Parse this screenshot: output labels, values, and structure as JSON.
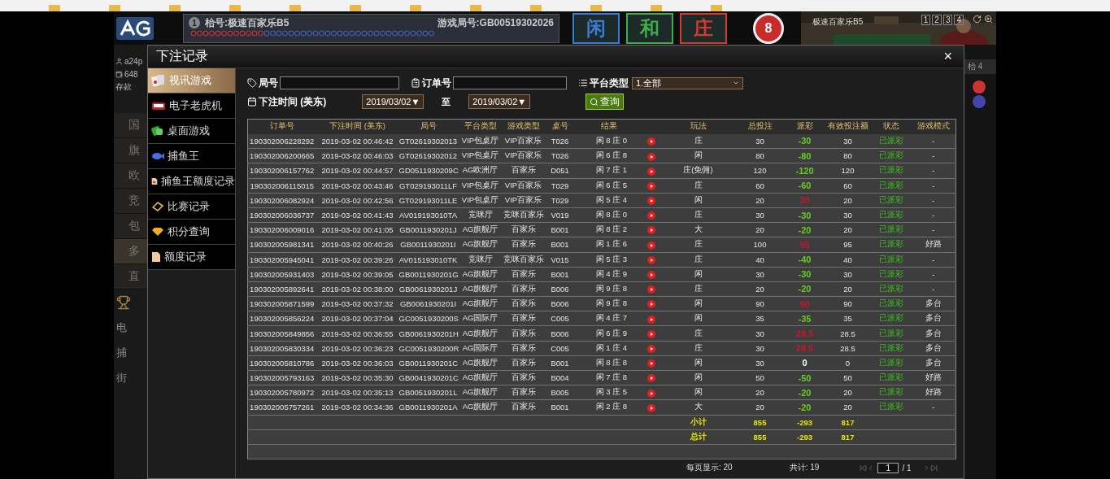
{
  "background": {
    "player": {
      "name": "a24p",
      "balance": "648",
      "deposit": "存款"
    },
    "header": {
      "table_number": "1",
      "table_name": "枱号:极速百家乐B5",
      "round": "游戏局号:GB00519302026",
      "bets": [
        {
          "label": "闲",
          "color": "#3a7bd5"
        },
        {
          "label": "和",
          "color": "#3fae49"
        },
        {
          "label": "庄",
          "color": "#d33a2c"
        }
      ],
      "result_number": "8"
    },
    "video": {
      "title": "极速百家乐B5",
      "views": [
        {
          "label": "1",
          "selected": false
        },
        {
          "label": "2",
          "selected": false
        },
        {
          "label": "3",
          "selected": false
        },
        {
          "label": "4",
          "selected": false
        }
      ]
    },
    "menu": [
      {
        "label": "国",
        "selected": false
      },
      {
        "label": "旗",
        "selected": false
      },
      {
        "label": "欧",
        "selected": false
      },
      {
        "label": "竞",
        "selected": false
      },
      {
        "label": "包",
        "selected": false
      },
      {
        "label": "多",
        "selected": true
      },
      {
        "label": "直",
        "selected": false
      }
    ],
    "lower_menu": [
      "电",
      "捕",
      "街"
    ],
    "right_tab": "枱 4"
  },
  "dialog": {
    "title": "下注记录",
    "close": "×",
    "sidebar": [
      {
        "label": "视讯游戏",
        "selected": true
      },
      {
        "label": "电子老虎机",
        "selected": false
      },
      {
        "label": "桌面游戏",
        "selected": false
      },
      {
        "label": "捕鱼王",
        "selected": false
      },
      {
        "label": "捕鱼王额度记录",
        "selected": false
      },
      {
        "label": "比赛记录",
        "selected": false
      },
      {
        "label": "积分查询",
        "selected": false
      },
      {
        "label": "额度记录",
        "selected": false
      }
    ],
    "filters": {
      "round_label": "局号",
      "order_label": "订单号",
      "platform_label": "平台类型",
      "platform_value": "1.全部",
      "time_label": "下注时间 (美东)",
      "date_from": "2019/03/02▼",
      "to_label": "至",
      "date_to": "2019/03/02▼",
      "query_button": "查询"
    },
    "table": {
      "columns": [
        "订单号",
        "下注时间 (美东)",
        "局号",
        "平台类型",
        "游戏类型",
        "桌号",
        "结果",
        "玩法",
        "总投注",
        "派彩",
        "有效投注额",
        "状态",
        "游戏模式"
      ],
      "rows": [
        {
          "order_no": "190302006228292",
          "bet_time": "2019-03-02 00:46:42",
          "round_no": "GT02619302013",
          "platform": "VIP包桌厅",
          "game_type": "VIP百家乐",
          "table_no": "T026",
          "result": "闲 8 庄 0",
          "bet_type": "庄",
          "total_bet": "30",
          "payout": {
            "text": "-30",
            "color": "#66cc22"
          },
          "valid_bet": "30",
          "status": "已派彩",
          "mode": "-"
        },
        {
          "order_no": "190302006200665",
          "bet_time": "2019-03-02 00:46:03",
          "round_no": "GT02619302012",
          "platform": "VIP包桌厅",
          "game_type": "VIP百家乐",
          "table_no": "T026",
          "result": "闲 6 庄 8",
          "bet_type": "闲",
          "total_bet": "80",
          "payout": {
            "text": "-80",
            "color": "#66cc22"
          },
          "valid_bet": "80",
          "status": "已派彩",
          "mode": "-"
        },
        {
          "order_no": "190302006157762",
          "bet_time": "2019-03-02 00:44:57",
          "round_no": "GD0511930209C",
          "platform": "AG欧洲厅",
          "game_type": "百家乐",
          "table_no": "D051",
          "result": "闲 7 庄 1",
          "bet_type": "庄(免佣)",
          "total_bet": "120",
          "payout": {
            "text": "-120",
            "color": "#66cc22"
          },
          "valid_bet": "120",
          "status": "已派彩",
          "mode": "-"
        },
        {
          "order_no": "190302006115015",
          "bet_time": "2019-03-02 00:43:46",
          "round_no": "GT029193011LF",
          "platform": "VIP包桌厅",
          "game_type": "VIP百家乐",
          "table_no": "T029",
          "result": "闲 6 庄 5",
          "bet_type": "庄",
          "total_bet": "60",
          "payout": {
            "text": "-60",
            "color": "#66cc22"
          },
          "valid_bet": "60",
          "status": "已派彩",
          "mode": "-"
        },
        {
          "order_no": "190302006082924",
          "bet_time": "2019-03-02 00:42:56",
          "round_no": "GT029193011LE",
          "platform": "VIP包桌厅",
          "game_type": "VIP百家乐",
          "table_no": "T029",
          "result": "闲 5 庄 4",
          "bet_type": "闲",
          "total_bet": "20",
          "payout": {
            "text": "20",
            "color": "#c0182e"
          },
          "valid_bet": "20",
          "status": "已派彩",
          "mode": "-"
        },
        {
          "order_no": "190302006036737",
          "bet_time": "2019-03-02 00:41:43",
          "round_no": "AV019193010TA",
          "platform": "竞咪厅",
          "game_type": "竞咪百家乐",
          "table_no": "V019",
          "result": "闲 8 庄 0",
          "bet_type": "庄",
          "total_bet": "30",
          "payout": {
            "text": "-30",
            "color": "#66cc22"
          },
          "valid_bet": "30",
          "status": "已派彩",
          "mode": "-"
        },
        {
          "order_no": "190302006009016",
          "bet_time": "2019-03-02 00:41:05",
          "round_no": "GB0011930201J",
          "platform": "AG旗舰厅",
          "game_type": "百家乐",
          "table_no": "B001",
          "result": "闲 8 庄 2",
          "bet_type": "大",
          "total_bet": "20",
          "payout": {
            "text": "-20",
            "color": "#66cc22"
          },
          "valid_bet": "20",
          "status": "已派彩",
          "mode": "-"
        },
        {
          "order_no": "190302005981341",
          "bet_time": "2019-03-02 00:40:26",
          "round_no": "GB0011930201I",
          "platform": "AG旗舰厅",
          "game_type": "百家乐",
          "table_no": "B001",
          "result": "闲 1 庄 6",
          "bet_type": "庄",
          "total_bet": "100",
          "payout": {
            "text": "95",
            "color": "#c0182e"
          },
          "valid_bet": "95",
          "status": "已派彩",
          "mode": "好路"
        },
        {
          "order_no": "190302005945041",
          "bet_time": "2019-03-02 00:39:26",
          "round_no": "AV015193010TK",
          "platform": "竞咪厅",
          "game_type": "竞咪百家乐",
          "table_no": "V015",
          "result": "闲 5 庄 3",
          "bet_type": "庄",
          "total_bet": "40",
          "payout": {
            "text": "-40",
            "color": "#66cc22"
          },
          "valid_bet": "40",
          "status": "已派彩",
          "mode": "-"
        },
        {
          "order_no": "190302005931403",
          "bet_time": "2019-03-02 00:39:05",
          "round_no": "GB0011930201G",
          "platform": "AG旗舰厅",
          "game_type": "百家乐",
          "table_no": "B001",
          "result": "闲 4 庄 9",
          "bet_type": "闲",
          "total_bet": "30",
          "payout": {
            "text": "-30",
            "color": "#66cc22"
          },
          "valid_bet": "30",
          "status": "已派彩",
          "mode": "-"
        },
        {
          "order_no": "190302005892641",
          "bet_time": "2019-03-02 00:38:00",
          "round_no": "GB0061930201J",
          "platform": "AG旗舰厅",
          "game_type": "百家乐",
          "table_no": "B006",
          "result": "闲 9 庄 8",
          "bet_type": "庄",
          "total_bet": "20",
          "payout": {
            "text": "-20",
            "color": "#66cc22"
          },
          "valid_bet": "20",
          "status": "已派彩",
          "mode": "-"
        },
        {
          "order_no": "190302005871599",
          "bet_time": "2019-03-02 00:37:32",
          "round_no": "GB0061930201I",
          "platform": "AG旗舰厅",
          "game_type": "百家乐",
          "table_no": "B006",
          "result": "闲 9 庄 8",
          "bet_type": "闲",
          "total_bet": "90",
          "payout": {
            "text": "90",
            "color": "#c0182e"
          },
          "valid_bet": "90",
          "status": "已派彩",
          "mode": "多台"
        },
        {
          "order_no": "190302005856224",
          "bet_time": "2019-03-02 00:37:04",
          "round_no": "GC0051930200S",
          "platform": "AG国际厅",
          "game_type": "百家乐",
          "table_no": "C005",
          "result": "闲 4 庄 7",
          "bet_type": "闲",
          "total_bet": "35",
          "payout": {
            "text": "-35",
            "color": "#66cc22"
          },
          "valid_bet": "35",
          "status": "已派彩",
          "mode": "多台"
        },
        {
          "order_no": "190302005849856",
          "bet_time": "2019-03-02 00:36:55",
          "round_no": "GB0061930201H",
          "platform": "AG旗舰厅",
          "game_type": "百家乐",
          "table_no": "B006",
          "result": "闲 6 庄 9",
          "bet_type": "庄",
          "total_bet": "30",
          "payout": {
            "text": "28.5",
            "color": "#c0182e"
          },
          "valid_bet": "28.5",
          "status": "已派彩",
          "mode": "多台"
        },
        {
          "order_no": "190302005830334",
          "bet_time": "2019-03-02 00:36:23",
          "round_no": "GC0051930200R",
          "platform": "AG国际厅",
          "game_type": "百家乐",
          "table_no": "C005",
          "result": "闲 1 庄 4",
          "bet_type": "庄",
          "total_bet": "30",
          "payout": {
            "text": "28.5",
            "color": "#c0182e"
          },
          "valid_bet": "28.5",
          "status": "已派彩",
          "mode": "多台"
        },
        {
          "order_no": "190302005810786",
          "bet_time": "2019-03-02 00:36:03",
          "round_no": "GB0011930201C",
          "platform": "AG旗舰厅",
          "game_type": "百家乐",
          "table_no": "B001",
          "result": "闲 8 庄 8",
          "bet_type": "闲",
          "total_bet": "30",
          "payout": {
            "text": "0",
            "color": "#ffffff"
          },
          "valid_bet": "0",
          "status": "已派彩",
          "mode": "多台"
        },
        {
          "order_no": "190302005793163",
          "bet_time": "2019-03-02 00:35:30",
          "round_no": "GB0041930201C",
          "platform": "AG旗舰厅",
          "game_type": "百家乐",
          "table_no": "B004",
          "result": "闲 7 庄 8",
          "bet_type": "闲",
          "total_bet": "50",
          "payout": {
            "text": "-50",
            "color": "#66cc22"
          },
          "valid_bet": "50",
          "status": "已派彩",
          "mode": "好路"
        },
        {
          "order_no": "190302005780972",
          "bet_time": "2019-03-02 00:35:13",
          "round_no": "GB0051930201L",
          "platform": "AG旗舰厅",
          "game_type": "百家乐",
          "table_no": "B005",
          "result": "闲 3 庄 5",
          "bet_type": "闲",
          "total_bet": "20",
          "payout": {
            "text": "-20",
            "color": "#66cc22"
          },
          "valid_bet": "20",
          "status": "已派彩",
          "mode": "好路"
        },
        {
          "order_no": "190302005757261",
          "bet_time": "2019-03-02 00:34:36",
          "round_no": "GB0011930201A",
          "platform": "AG旗舰厅",
          "game_type": "百家乐",
          "table_no": "B001",
          "result": "闲 2 庄 8",
          "bet_type": "大",
          "total_bet": "20",
          "payout": {
            "text": "-20",
            "color": "#66cc22"
          },
          "valid_bet": "20",
          "status": "已派彩",
          "mode": "-"
        }
      ],
      "totals": [
        {
          "label": "小计",
          "total_bet": "855",
          "payout": "-293",
          "valid_bet": "817"
        },
        {
          "label": "总计",
          "total_bet": "855",
          "payout": "-293",
          "valid_bet": "817"
        }
      ]
    },
    "pagination": {
      "per_page": "每页显示: 20",
      "total": "共计: 19",
      "page": "1",
      "pages": "/ 1"
    }
  }
}
